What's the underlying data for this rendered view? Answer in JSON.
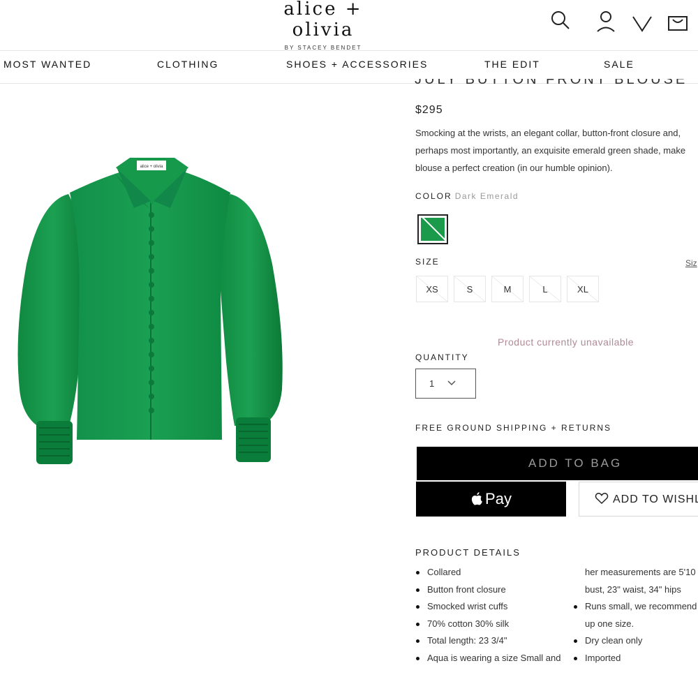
{
  "header": {
    "logo_main": "alice + olivia",
    "logo_sub": "BY STACEY BENDET",
    "icons": [
      "search-icon",
      "account-icon",
      "wishlist-heart-icon",
      "shopping-bag-icon"
    ]
  },
  "nav": {
    "items": [
      "MOST WANTED",
      "CLOTHING",
      "SHOES + ACCESSORIES",
      "THE EDIT",
      "SALE"
    ]
  },
  "product": {
    "title": "JULY BUTTON FRONT BLOUSE",
    "price": "$295",
    "description": "Smocking at the wrists, an elegant collar, button-front closure and, perhaps most importantly, an exquisite emerald green shade, make blouse a perfect creation (in our humble opinion).",
    "color_label": "COLOR",
    "color_value": "Dark Emerald",
    "swatch_color": "#1a9a4a",
    "size_label": "SIZE",
    "size_guide": "Siz",
    "sizes": [
      "XS",
      "S",
      "M",
      "L",
      "XL"
    ],
    "unavailable_text": "Product currently unavailable",
    "quantity_label": "QUANTITY",
    "quantity_value": "1",
    "shipping_text": "FREE GROUND SHIPPING + RETURNS",
    "add_to_bag": "ADD TO BAG",
    "apple_pay": "Pay",
    "wishlist": "ADD TO WISHLI",
    "details_title": "PRODUCT DETAILS",
    "details_left": [
      {
        "bullet": true,
        "text": "Collared"
      },
      {
        "bullet": true,
        "text": "Button front closure"
      },
      {
        "bullet": true,
        "text": "Smocked wrist cuffs"
      },
      {
        "bullet": true,
        "text": "70% cotton 30% silk"
      },
      {
        "bullet": true,
        "text": "Total length: 23 3/4\""
      },
      {
        "bullet": true,
        "text": "Aqua is wearing a size Small and"
      }
    ],
    "details_right": [
      {
        "bullet": false,
        "text": "her measurements are 5'10"
      },
      {
        "bullet": false,
        "text": "bust, 23\" waist, 34\" hips"
      },
      {
        "bullet": true,
        "text": "Runs small, we recommend"
      },
      {
        "bullet": false,
        "text": "up one size."
      },
      {
        "bullet": true,
        "text": "Dry clean only"
      },
      {
        "bullet": true,
        "text": "Imported"
      }
    ],
    "image_label": "alice + olivia",
    "colors": {
      "blouse": "#14924a",
      "blouse_dark": "#0b7a3a",
      "unavailable_text": "#b08a95",
      "button_bg": "#000000"
    }
  }
}
